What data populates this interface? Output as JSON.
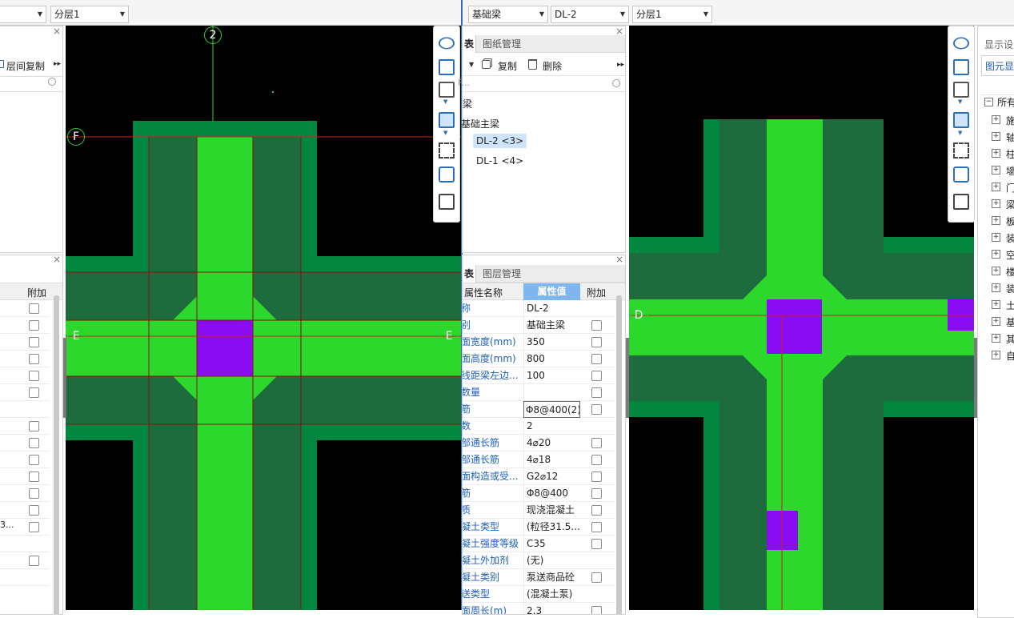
{
  "toolbar_left": {
    "floor_select": "分层1"
  },
  "toolbar_right": {
    "category_select": "基础梁",
    "component_select": "DL-2",
    "floor_select": "分层1"
  },
  "left_panel": {
    "copy_label": "层间复制",
    "close": "×"
  },
  "left_props": {
    "close": "×",
    "add_header": "附加"
  },
  "component_list": {
    "tabs": [
      "表",
      "图纸管理"
    ],
    "copy_label": "复制",
    "delete_label": "删除",
    "search_placeholder": "F...",
    "tree": [
      "梁",
      "基础主梁",
      "DL-2 <3>",
      "DL-1 <4>"
    ],
    "close": "×"
  },
  "properties": {
    "tabs": [
      "表",
      "图层管理"
    ],
    "close": "×",
    "headers": {
      "name": "属性名称",
      "value": "属性值",
      "add": "附加"
    },
    "rows": [
      {
        "name": "称",
        "value": "DL-2"
      },
      {
        "name": "别",
        "value": "基础主梁"
      },
      {
        "name": "面宽度(mm)",
        "value": "350"
      },
      {
        "name": "面高度(mm)",
        "value": "800"
      },
      {
        "name": "线距梁左边...",
        "value": "100"
      },
      {
        "name": "数量",
        "value": ""
      },
      {
        "name": "筋",
        "value": "Φ8@400(2)"
      },
      {
        "name": "数",
        "value": "2"
      },
      {
        "name": "部通长筋",
        "value": "4⌀20"
      },
      {
        "name": "部通长筋",
        "value": "4⌀18"
      },
      {
        "name": "面构造或受...",
        "value": "G2⌀12"
      },
      {
        "name": "筋",
        "value": "Φ8@400"
      },
      {
        "name": "质",
        "value": "现浇混凝土"
      },
      {
        "name": "凝土类型",
        "value": "(粒径31.5..."
      },
      {
        "name": "凝土强度等级",
        "value": "C35"
      },
      {
        "name": "凝土外加剂",
        "value": "(无)"
      },
      {
        "name": "凝土类别",
        "value": "泵送商品砼"
      },
      {
        "name": "送类型",
        "value": "(混凝土泵)"
      },
      {
        "name": "面周长(m)",
        "value": "2.3"
      }
    ]
  },
  "canvas_left": {
    "axis_labels": [
      "2",
      "F",
      "E",
      "E"
    ]
  },
  "canvas_right": {
    "axis_labels": [
      "D"
    ]
  },
  "view_tools": [
    "orbit-icon",
    "3d-view-icon",
    "top-view-icon",
    "face-view-icon",
    "fullscreen-icon",
    "box-select-icon",
    "display-settings-icon"
  ],
  "display_panel": {
    "title": "显示设",
    "tab": "图元显",
    "root": "所有",
    "items": [
      "施",
      "轴",
      "柱",
      "墙",
      "门",
      "梁",
      "板",
      "装",
      "空",
      "楼",
      "装",
      "土",
      "基",
      "其",
      "自"
    ]
  },
  "colors": {
    "beam_light": "#2bd82b",
    "beam_dark": "#1e6b3e",
    "found_green": "#03863f",
    "column": "#8a0df2",
    "axis_red": "#c82020",
    "canvas_bg": "#000000",
    "select_blue": "#7fb6f0"
  }
}
